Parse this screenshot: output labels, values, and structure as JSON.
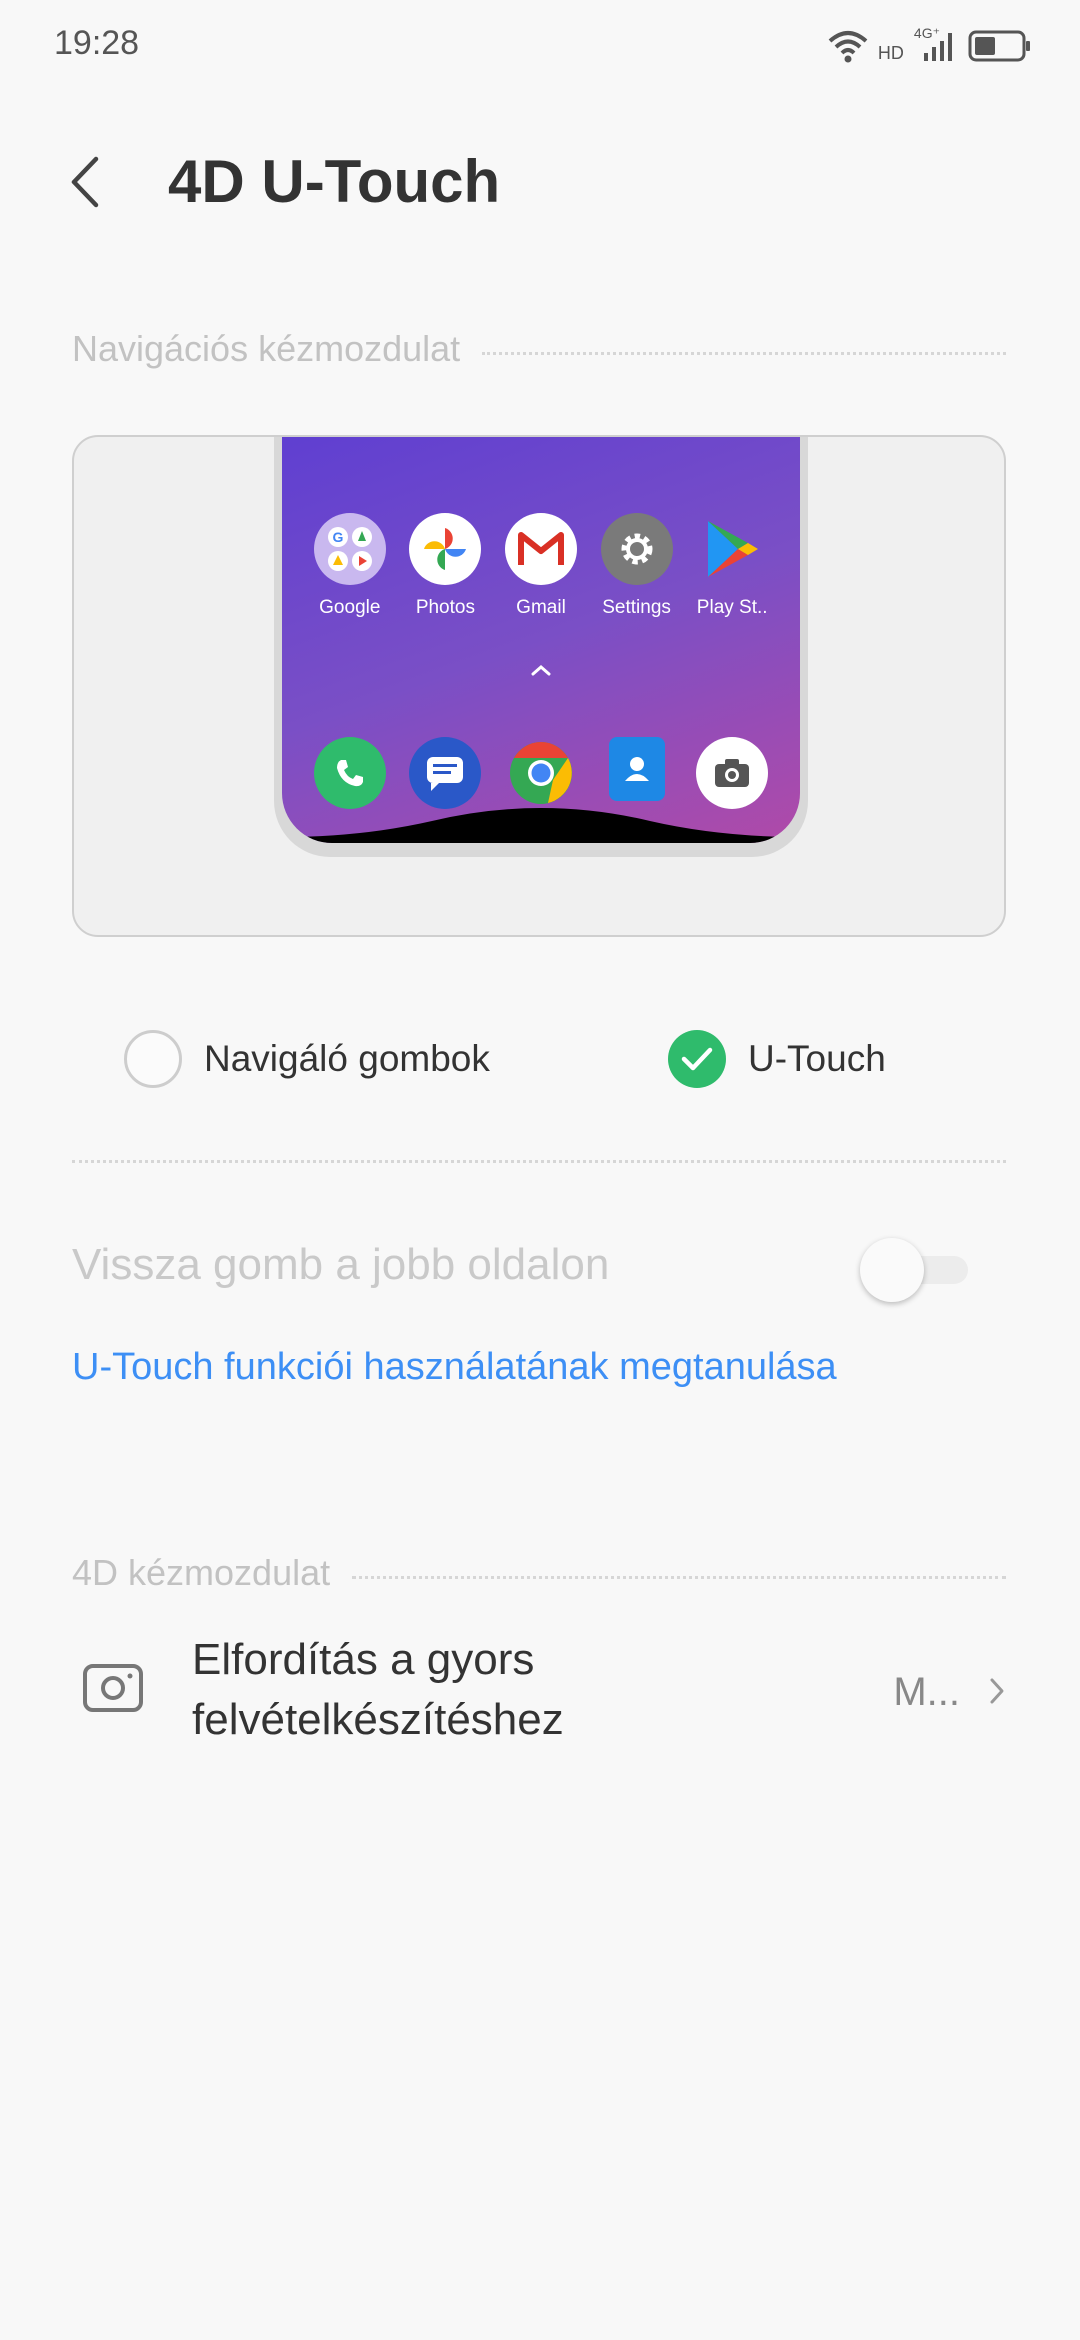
{
  "status_bar": {
    "time": "19:28",
    "network_badge": "HD",
    "network_type": "4G⁺",
    "icons": [
      "wifi-icon",
      "signal-icon",
      "battery-icon"
    ]
  },
  "header": {
    "title": "4D U-Touch",
    "back_icon": "back-arrow-icon"
  },
  "navigation_section": {
    "header": "Navigációs kézmozdulat",
    "preview": {
      "apps": [
        {
          "label": "Google",
          "icon": "google-folder-icon"
        },
        {
          "label": "Photos",
          "icon": "photos-icon"
        },
        {
          "label": "Gmail",
          "icon": "gmail-icon"
        },
        {
          "label": "Settings",
          "icon": "settings-icon"
        },
        {
          "label": "Play St..",
          "icon": "play-store-icon"
        }
      ],
      "dock": [
        "phone-icon",
        "messages-icon",
        "chrome-icon",
        "contacts-icon",
        "camera-icon"
      ]
    },
    "options": [
      {
        "label": "Navigáló gombok",
        "selected": false
      },
      {
        "label": "U-Touch",
        "selected": true
      }
    ],
    "back_button_right": {
      "label": "Vissza gomb a jobb oldalon",
      "enabled": false,
      "on": false
    },
    "learn_link": "U-Touch funkciói használatának megtanulása"
  },
  "gesture_section": {
    "header": "4D kézmozdulat",
    "item": {
      "title": "Elfordítás a gyors felvételkészítéshez",
      "value": "M...",
      "icon": "camera-outline-icon"
    }
  },
  "colors": {
    "accent_green": "#2fbb6c",
    "link_blue": "#3d8ff5",
    "disabled_text": "#c9c9c9"
  }
}
